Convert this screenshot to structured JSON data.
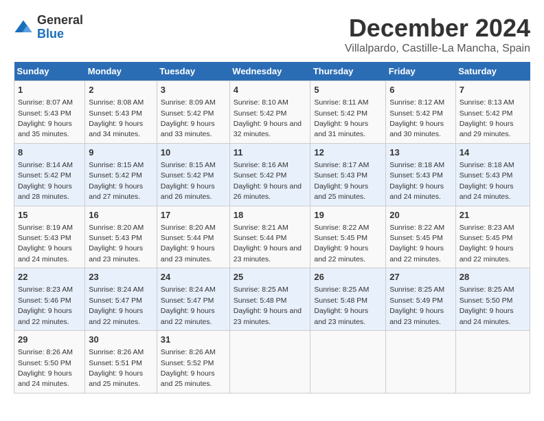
{
  "logo": {
    "general": "General",
    "blue": "Blue"
  },
  "title": "December 2024",
  "subtitle": "Villalpardo, Castille-La Mancha, Spain",
  "days_of_week": [
    "Sunday",
    "Monday",
    "Tuesday",
    "Wednesday",
    "Thursday",
    "Friday",
    "Saturday"
  ],
  "weeks": [
    [
      {
        "day": "1",
        "sunrise": "Sunrise: 8:07 AM",
        "sunset": "Sunset: 5:43 PM",
        "daylight": "Daylight: 9 hours and 35 minutes."
      },
      {
        "day": "2",
        "sunrise": "Sunrise: 8:08 AM",
        "sunset": "Sunset: 5:43 PM",
        "daylight": "Daylight: 9 hours and 34 minutes."
      },
      {
        "day": "3",
        "sunrise": "Sunrise: 8:09 AM",
        "sunset": "Sunset: 5:42 PM",
        "daylight": "Daylight: 9 hours and 33 minutes."
      },
      {
        "day": "4",
        "sunrise": "Sunrise: 8:10 AM",
        "sunset": "Sunset: 5:42 PM",
        "daylight": "Daylight: 9 hours and 32 minutes."
      },
      {
        "day": "5",
        "sunrise": "Sunrise: 8:11 AM",
        "sunset": "Sunset: 5:42 PM",
        "daylight": "Daylight: 9 hours and 31 minutes."
      },
      {
        "day": "6",
        "sunrise": "Sunrise: 8:12 AM",
        "sunset": "Sunset: 5:42 PM",
        "daylight": "Daylight: 9 hours and 30 minutes."
      },
      {
        "day": "7",
        "sunrise": "Sunrise: 8:13 AM",
        "sunset": "Sunset: 5:42 PM",
        "daylight": "Daylight: 9 hours and 29 minutes."
      }
    ],
    [
      {
        "day": "8",
        "sunrise": "Sunrise: 8:14 AM",
        "sunset": "Sunset: 5:42 PM",
        "daylight": "Daylight: 9 hours and 28 minutes."
      },
      {
        "day": "9",
        "sunrise": "Sunrise: 8:15 AM",
        "sunset": "Sunset: 5:42 PM",
        "daylight": "Daylight: 9 hours and 27 minutes."
      },
      {
        "day": "10",
        "sunrise": "Sunrise: 8:15 AM",
        "sunset": "Sunset: 5:42 PM",
        "daylight": "Daylight: 9 hours and 26 minutes."
      },
      {
        "day": "11",
        "sunrise": "Sunrise: 8:16 AM",
        "sunset": "Sunset: 5:42 PM",
        "daylight": "Daylight: 9 hours and 26 minutes."
      },
      {
        "day": "12",
        "sunrise": "Sunrise: 8:17 AM",
        "sunset": "Sunset: 5:43 PM",
        "daylight": "Daylight: 9 hours and 25 minutes."
      },
      {
        "day": "13",
        "sunrise": "Sunrise: 8:18 AM",
        "sunset": "Sunset: 5:43 PM",
        "daylight": "Daylight: 9 hours and 24 minutes."
      },
      {
        "day": "14",
        "sunrise": "Sunrise: 8:18 AM",
        "sunset": "Sunset: 5:43 PM",
        "daylight": "Daylight: 9 hours and 24 minutes."
      }
    ],
    [
      {
        "day": "15",
        "sunrise": "Sunrise: 8:19 AM",
        "sunset": "Sunset: 5:43 PM",
        "daylight": "Daylight: 9 hours and 24 minutes."
      },
      {
        "day": "16",
        "sunrise": "Sunrise: 8:20 AM",
        "sunset": "Sunset: 5:43 PM",
        "daylight": "Daylight: 9 hours and 23 minutes."
      },
      {
        "day": "17",
        "sunrise": "Sunrise: 8:20 AM",
        "sunset": "Sunset: 5:44 PM",
        "daylight": "Daylight: 9 hours and 23 minutes."
      },
      {
        "day": "18",
        "sunrise": "Sunrise: 8:21 AM",
        "sunset": "Sunset: 5:44 PM",
        "daylight": "Daylight: 9 hours and 23 minutes."
      },
      {
        "day": "19",
        "sunrise": "Sunrise: 8:22 AM",
        "sunset": "Sunset: 5:45 PM",
        "daylight": "Daylight: 9 hours and 22 minutes."
      },
      {
        "day": "20",
        "sunrise": "Sunrise: 8:22 AM",
        "sunset": "Sunset: 5:45 PM",
        "daylight": "Daylight: 9 hours and 22 minutes."
      },
      {
        "day": "21",
        "sunrise": "Sunrise: 8:23 AM",
        "sunset": "Sunset: 5:45 PM",
        "daylight": "Daylight: 9 hours and 22 minutes."
      }
    ],
    [
      {
        "day": "22",
        "sunrise": "Sunrise: 8:23 AM",
        "sunset": "Sunset: 5:46 PM",
        "daylight": "Daylight: 9 hours and 22 minutes."
      },
      {
        "day": "23",
        "sunrise": "Sunrise: 8:24 AM",
        "sunset": "Sunset: 5:47 PM",
        "daylight": "Daylight: 9 hours and 22 minutes."
      },
      {
        "day": "24",
        "sunrise": "Sunrise: 8:24 AM",
        "sunset": "Sunset: 5:47 PM",
        "daylight": "Daylight: 9 hours and 22 minutes."
      },
      {
        "day": "25",
        "sunrise": "Sunrise: 8:25 AM",
        "sunset": "Sunset: 5:48 PM",
        "daylight": "Daylight: 9 hours and 23 minutes."
      },
      {
        "day": "26",
        "sunrise": "Sunrise: 8:25 AM",
        "sunset": "Sunset: 5:48 PM",
        "daylight": "Daylight: 9 hours and 23 minutes."
      },
      {
        "day": "27",
        "sunrise": "Sunrise: 8:25 AM",
        "sunset": "Sunset: 5:49 PM",
        "daylight": "Daylight: 9 hours and 23 minutes."
      },
      {
        "day": "28",
        "sunrise": "Sunrise: 8:25 AM",
        "sunset": "Sunset: 5:50 PM",
        "daylight": "Daylight: 9 hours and 24 minutes."
      }
    ],
    [
      {
        "day": "29",
        "sunrise": "Sunrise: 8:26 AM",
        "sunset": "Sunset: 5:50 PM",
        "daylight": "Daylight: 9 hours and 24 minutes."
      },
      {
        "day": "30",
        "sunrise": "Sunrise: 8:26 AM",
        "sunset": "Sunset: 5:51 PM",
        "daylight": "Daylight: 9 hours and 25 minutes."
      },
      {
        "day": "31",
        "sunrise": "Sunrise: 8:26 AM",
        "sunset": "Sunset: 5:52 PM",
        "daylight": "Daylight: 9 hours and 25 minutes."
      },
      null,
      null,
      null,
      null
    ]
  ]
}
